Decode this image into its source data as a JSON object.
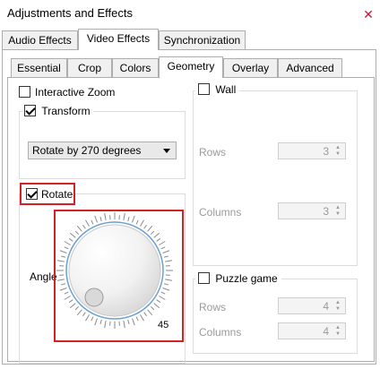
{
  "window": {
    "title": "Adjustments and Effects",
    "close_glyph": "✕"
  },
  "outer_tabs": [
    "Audio Effects",
    "Video Effects",
    "Synchronization"
  ],
  "inner_tabs": [
    "Essential",
    "Crop",
    "Colors",
    "Geometry",
    "Overlay",
    "Advanced"
  ],
  "geometry": {
    "interactive_zoom": {
      "label": "Interactive Zoom",
      "checked": false
    },
    "transform": {
      "label": "Transform",
      "checked": true,
      "selected": "Rotate by 270 degrees"
    },
    "rotate": {
      "label": "Rotate",
      "checked": true,
      "angle_label": "Angle",
      "dial_value": "45"
    },
    "wall": {
      "label": "Wall",
      "checked": false,
      "rows_label": "Rows",
      "rows_value": "3",
      "columns_label": "Columns",
      "columns_value": "3"
    },
    "puzzle": {
      "label": "Puzzle game",
      "checked": false,
      "rows_label": "Rows",
      "rows_value": "4",
      "columns_label": "Columns",
      "columns_value": "4"
    }
  },
  "colors": {
    "highlight": "#d42027",
    "dial_ring": "#6aa0d0"
  }
}
